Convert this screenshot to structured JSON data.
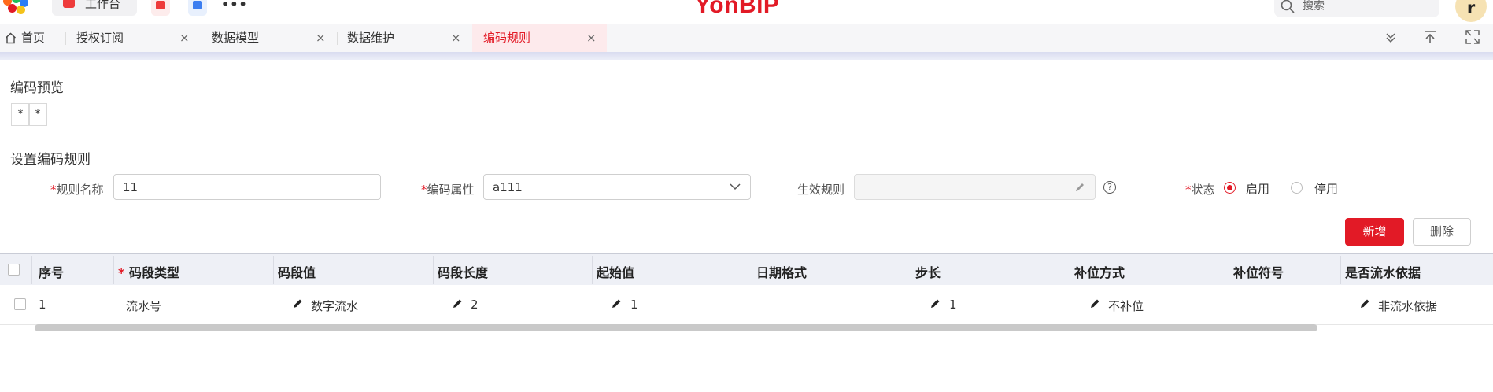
{
  "topbar": {
    "workbench_label": "工作台",
    "more_label": "•••",
    "brand": "YonBIP",
    "search_placeholder": "搜索",
    "avatar_letter": "r"
  },
  "tabs": {
    "home": "首页",
    "items": [
      {
        "label": "授权订阅"
      },
      {
        "label": "数据模型"
      },
      {
        "label": "数据维护"
      },
      {
        "label": "编码规则"
      }
    ],
    "active_index": 3,
    "close_glyph": "×"
  },
  "colors": {
    "accent": "#e21a26",
    "header_bg": "#eef0f6",
    "active_tab_bg": "#fdeaec"
  },
  "preview": {
    "title": "编码预览",
    "cells": [
      "*",
      "*"
    ]
  },
  "rule_form": {
    "title": "设置编码规则",
    "required_mark": "*",
    "name_label": "规则名称",
    "name_value": "11",
    "attr_label": "编码属性",
    "attr_value": "a111",
    "effect_label": "生效规则",
    "effect_value": "",
    "status_label": "状态",
    "status_options": [
      "启用",
      "停用"
    ],
    "status_selected": "启用",
    "help_glyph": "?"
  },
  "actions": {
    "add": "新增",
    "delete": "删除"
  },
  "table": {
    "columns": [
      "序号",
      "码段类型",
      "码段值",
      "码段长度",
      "起始值",
      "日期格式",
      "步长",
      "补位方式",
      "补位符号",
      "是否流水依据"
    ],
    "rows": [
      {
        "seq": "1",
        "seg_type": "流水号",
        "seg_value": "数字流水",
        "seg_length": "2",
        "start_value": "1",
        "date_format": "",
        "step": "1",
        "pad_mode": "不补位",
        "pad_symbol": "",
        "is_serial_basis": "非流水依据"
      }
    ]
  },
  "icons": [
    "logo-icon",
    "workbench-icon",
    "app-red-icon",
    "app-blue-icon",
    "search-icon",
    "home-icon",
    "close-icon",
    "collapse-icon",
    "upload-icon",
    "fullscreen-icon",
    "chevron-down-icon",
    "edit-icon",
    "help-icon",
    "pencil-icon"
  ]
}
